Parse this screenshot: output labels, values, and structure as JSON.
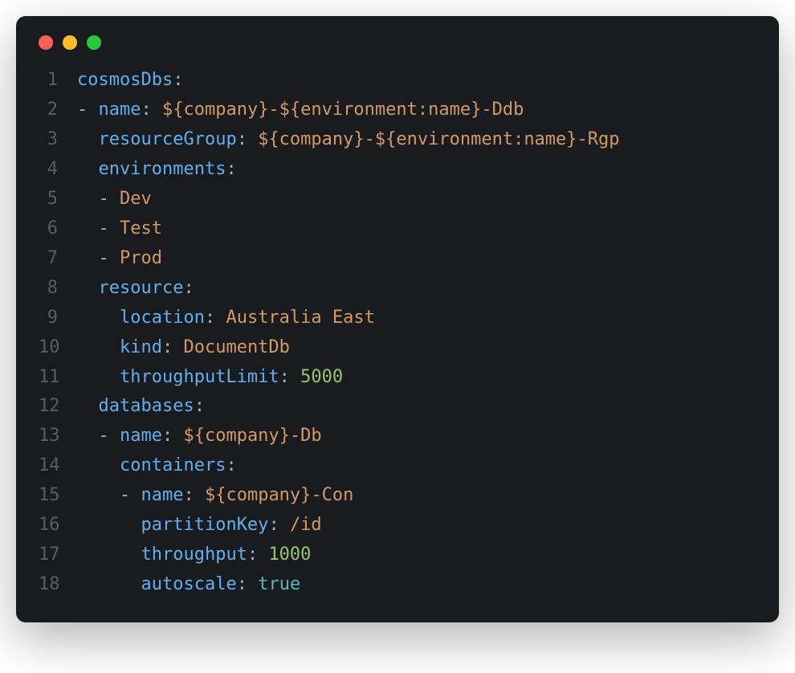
{
  "colors": {
    "red": "#ff5f56",
    "yellow": "#ffbd2e",
    "green": "#27c93f",
    "bg": "#1a1b1e",
    "lineno": "#5a5d64",
    "key": "#61afef",
    "string": "#d19a66",
    "plain": "#abb2bf",
    "number": "#98c379",
    "bool": "#56b6c2"
  },
  "lines": [
    {
      "no": "1",
      "tokens": [
        {
          "t": "cosmosDbs",
          "c": "key"
        },
        {
          "t": ":",
          "c": "plain"
        }
      ]
    },
    {
      "no": "2",
      "tokens": [
        {
          "t": "- ",
          "c": "plain"
        },
        {
          "t": "name",
          "c": "key"
        },
        {
          "t": ": ",
          "c": "plain"
        },
        {
          "t": "${company}-${environment:name}-Ddb",
          "c": "str"
        }
      ]
    },
    {
      "no": "3",
      "tokens": [
        {
          "t": "  ",
          "c": "plain"
        },
        {
          "t": "resourceGroup",
          "c": "key"
        },
        {
          "t": ": ",
          "c": "plain"
        },
        {
          "t": "${company}-${environment:name}-Rgp",
          "c": "str"
        }
      ]
    },
    {
      "no": "4",
      "tokens": [
        {
          "t": "  ",
          "c": "plain"
        },
        {
          "t": "environments",
          "c": "key"
        },
        {
          "t": ":",
          "c": "plain"
        }
      ]
    },
    {
      "no": "5",
      "tokens": [
        {
          "t": "  - ",
          "c": "plain"
        },
        {
          "t": "Dev",
          "c": "str"
        }
      ]
    },
    {
      "no": "6",
      "tokens": [
        {
          "t": "  - ",
          "c": "plain"
        },
        {
          "t": "Test",
          "c": "str"
        }
      ]
    },
    {
      "no": "7",
      "tokens": [
        {
          "t": "  - ",
          "c": "plain"
        },
        {
          "t": "Prod",
          "c": "str"
        }
      ]
    },
    {
      "no": "8",
      "tokens": [
        {
          "t": "  ",
          "c": "plain"
        },
        {
          "t": "resource",
          "c": "key"
        },
        {
          "t": ":",
          "c": "plain"
        }
      ]
    },
    {
      "no": "9",
      "tokens": [
        {
          "t": "    ",
          "c": "plain"
        },
        {
          "t": "location",
          "c": "key"
        },
        {
          "t": ": ",
          "c": "plain"
        },
        {
          "t": "Australia East",
          "c": "str"
        }
      ]
    },
    {
      "no": "10",
      "tokens": [
        {
          "t": "    ",
          "c": "plain"
        },
        {
          "t": "kind",
          "c": "key"
        },
        {
          "t": ": ",
          "c": "plain"
        },
        {
          "t": "DocumentDb",
          "c": "str"
        }
      ]
    },
    {
      "no": "11",
      "tokens": [
        {
          "t": "    ",
          "c": "plain"
        },
        {
          "t": "throughputLimit",
          "c": "key"
        },
        {
          "t": ": ",
          "c": "plain"
        },
        {
          "t": "5000",
          "c": "num"
        }
      ]
    },
    {
      "no": "12",
      "tokens": [
        {
          "t": "  ",
          "c": "plain"
        },
        {
          "t": "databases",
          "c": "key"
        },
        {
          "t": ":",
          "c": "plain"
        }
      ]
    },
    {
      "no": "13",
      "tokens": [
        {
          "t": "  - ",
          "c": "plain"
        },
        {
          "t": "name",
          "c": "key"
        },
        {
          "t": ": ",
          "c": "plain"
        },
        {
          "t": "${company}-Db",
          "c": "str"
        }
      ]
    },
    {
      "no": "14",
      "tokens": [
        {
          "t": "    ",
          "c": "plain"
        },
        {
          "t": "containers",
          "c": "key"
        },
        {
          "t": ":",
          "c": "plain"
        }
      ]
    },
    {
      "no": "15",
      "tokens": [
        {
          "t": "    - ",
          "c": "plain"
        },
        {
          "t": "name",
          "c": "key"
        },
        {
          "t": ": ",
          "c": "plain"
        },
        {
          "t": "${company}-Con",
          "c": "str"
        }
      ]
    },
    {
      "no": "16",
      "tokens": [
        {
          "t": "      ",
          "c": "plain"
        },
        {
          "t": "partitionKey",
          "c": "key"
        },
        {
          "t": ": ",
          "c": "plain"
        },
        {
          "t": "/id",
          "c": "str"
        }
      ]
    },
    {
      "no": "17",
      "tokens": [
        {
          "t": "      ",
          "c": "plain"
        },
        {
          "t": "throughput",
          "c": "key"
        },
        {
          "t": ": ",
          "c": "plain"
        },
        {
          "t": "1000",
          "c": "num"
        }
      ]
    },
    {
      "no": "18",
      "tokens": [
        {
          "t": "      ",
          "c": "plain"
        },
        {
          "t": "autoscale",
          "c": "key"
        },
        {
          "t": ": ",
          "c": "plain"
        },
        {
          "t": "true",
          "c": "bool"
        }
      ]
    }
  ]
}
